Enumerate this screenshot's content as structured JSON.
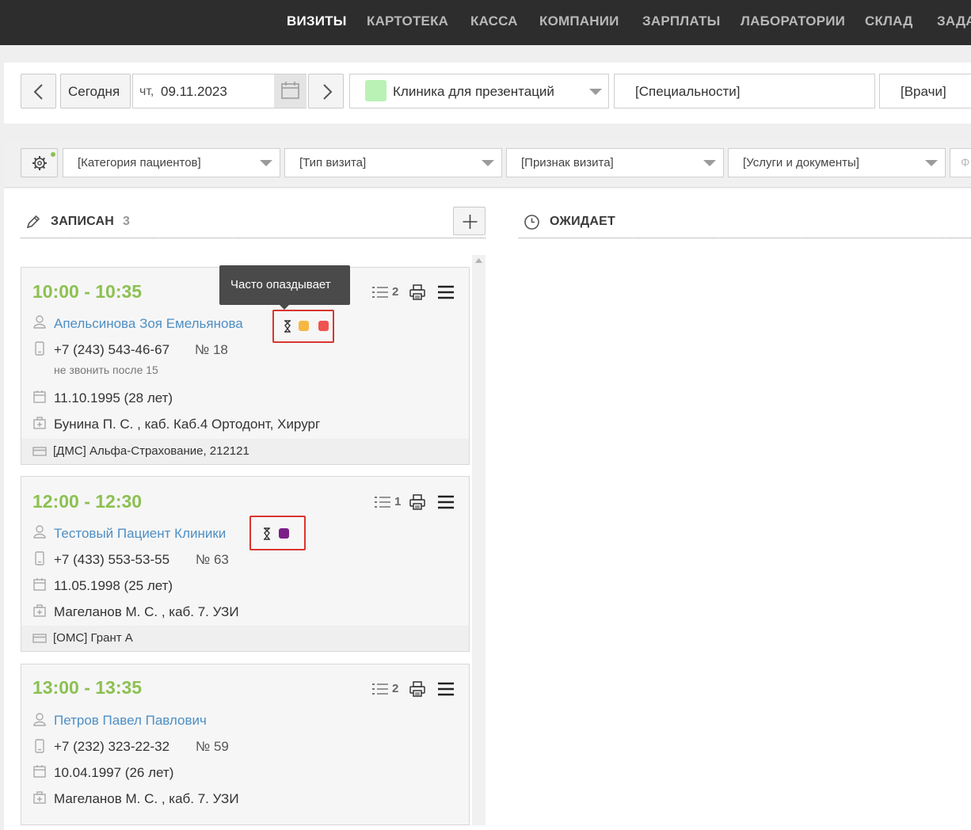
{
  "nav": {
    "items": [
      "ВИЗИТЫ",
      "КАРТОТЕКА",
      "КАССА",
      "КОМПАНИИ",
      "ЗАРПЛАТЫ",
      "ЛАБОРАТОРИИ",
      "СКЛАД",
      "ЗАДА"
    ]
  },
  "toolbar": {
    "today": "Сегодня",
    "date_weekday": "чт,",
    "date": "09.11.2023",
    "clinic": "Клиника для презентаций",
    "clinic_color": "#b9f2b4",
    "specialties": "[Специальности]",
    "doctors": "[Врачи]"
  },
  "filters": {
    "category": "[Категория пациентов]",
    "visit_type": "[Тип визита]",
    "visit_sign": "[Признак визита]",
    "services": "[Услуги и документы]",
    "partial": "Ф"
  },
  "columns": {
    "booked": {
      "title": "ЗАПИСАН",
      "count": "3"
    },
    "waiting": {
      "title": "ОЖИДАЕТ"
    }
  },
  "tooltip": "Часто опаздывает",
  "cards": [
    {
      "time": "10:00 - 10:35",
      "services_count": "2",
      "patient": "Апельсинова Зоя Емельянова",
      "phone": "+7 (243) 543-46-67",
      "number": "№ 18",
      "note": "не звонить после 15",
      "birth": "11.10.1995 (28 лет)",
      "doctor": "Бунина П. С. , каб. Каб.4 Ортодонт, Хирург",
      "insurance": "[ДМС] Альфа-Страхование, 212121",
      "tag_colors": [
        "#f5b942",
        "#ef5350"
      ]
    },
    {
      "time": "12:00 - 12:30",
      "services_count": "1",
      "patient": "Тестовый Пациент Клиники",
      "phone": "+7 (433) 553-53-55",
      "number": "№ 63",
      "birth": "11.05.1998 (25 лет)",
      "doctor": "Магеланов М. С. , каб. 7. УЗИ",
      "insurance": "[ОМС] Грант А",
      "tag_colors": [
        "#7b1f87"
      ]
    },
    {
      "time": "13:00 - 13:35",
      "services_count": "2",
      "patient": "Петров Павел Павлович",
      "phone": "+7 (232) 323-22-32",
      "number": "№ 59",
      "birth": "10.04.1997 (26 лет)",
      "doctor": "Магеланов М. С. , каб. 7. УЗИ"
    }
  ]
}
